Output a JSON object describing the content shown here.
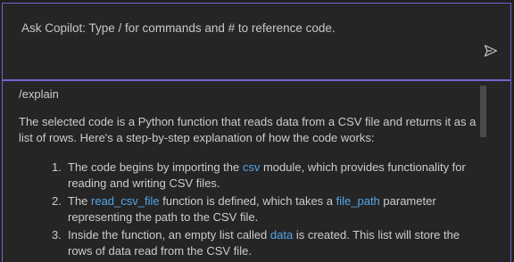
{
  "input": {
    "placeholder": "Ask Copilot: Type / for commands and # to reference code."
  },
  "send_icon": "send-icon",
  "colors": {
    "accent_border": "#7b5fcf",
    "code_reference": "#56a5e8",
    "panel_bg": "#252526"
  },
  "response": {
    "command": "/explain",
    "intro": "The selected code is a Python function that reads data from a CSV file and returns it as a list of rows. Here's a step-by-step explanation of how the code works:",
    "steps": [
      {
        "number": "1.",
        "pre": "The code begins by importing the ",
        "code": "csv",
        "mid": " module, which provides functionality for reading and writing CSV files.",
        "code2": "",
        "post": ""
      },
      {
        "number": "2.",
        "pre": "The ",
        "code": "read_csv_file",
        "mid": " function is defined, which takes a ",
        "code2": "file_path",
        "post": " parameter representing the path to the CSV file."
      },
      {
        "number": "3.",
        "pre": "Inside the function, an empty list called ",
        "code": "data",
        "mid": " is created. This list will store the rows of data read from the CSV file.",
        "code2": "",
        "post": ""
      }
    ]
  }
}
